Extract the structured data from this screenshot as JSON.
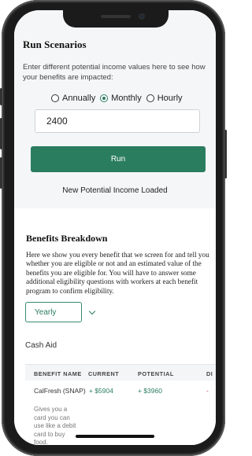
{
  "scenarios": {
    "title": "Run Scenarios",
    "description": "Enter different potential income values here to see how your benefits are impacted:",
    "frequency_options": [
      "Annually",
      "Monthly",
      "Hourly"
    ],
    "selected_frequency": "Monthly",
    "income_value": "2400",
    "run_label": "Run",
    "status": "New Potential Income Loaded"
  },
  "breakdown": {
    "title": "Benefits Breakdown",
    "description": "Here we show you every benefit that we screen for and tell you whether you are eligible or not and an estimated value of the benefits you are eligible for. You will have to answer some additional eligibility questions with workers at each benefit program to confirm eligibility.",
    "frequency": "Yearly",
    "section": "Cash Aid",
    "table": {
      "headers": [
        "BENEFIT NAME",
        "CURRENT",
        "POTENTIAL",
        "DI"
      ],
      "rows": [
        {
          "name": "CalFresh (SNAP)",
          "description": "Gives you a card you can use like a debit card to buy food.",
          "current": "+ $5904",
          "potential": "+ $3960",
          "difference": "-"
        }
      ]
    }
  },
  "colors": {
    "accent": "#2b7d5f",
    "section_background": "#f5f6f7",
    "negative": "#c23a3a"
  }
}
